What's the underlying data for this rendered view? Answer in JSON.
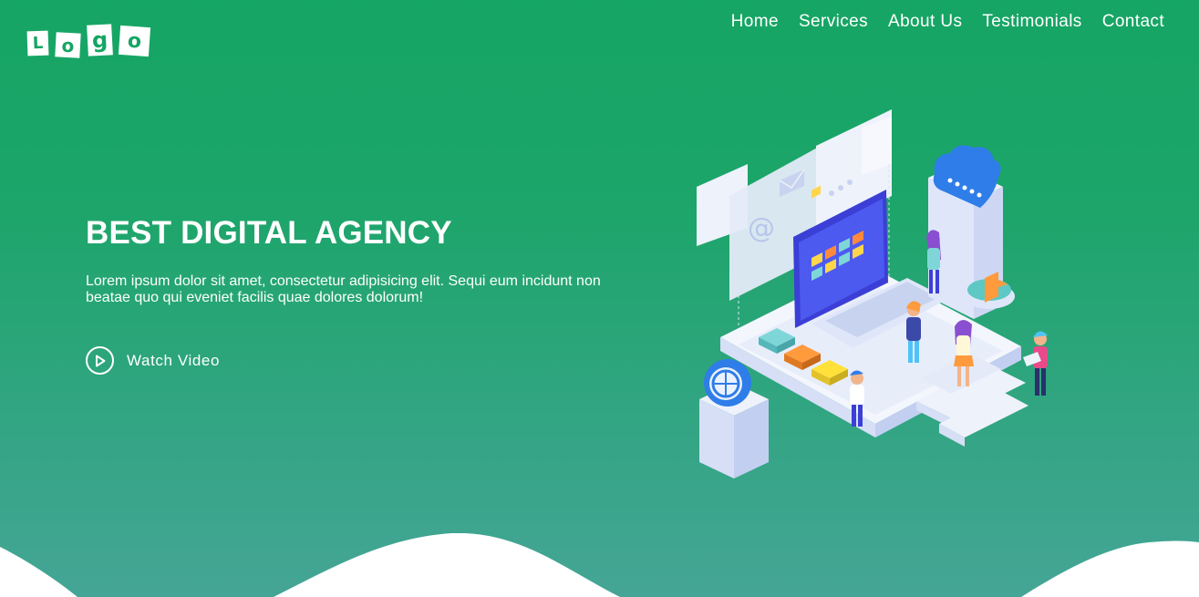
{
  "logo": {
    "letters": [
      "L",
      "o",
      "g",
      "o"
    ]
  },
  "nav": {
    "items": [
      "Home",
      "Services",
      "About Us",
      "Testimonials",
      "Contact"
    ]
  },
  "hero": {
    "title": "BEST DIGITAL AGENCY",
    "text": "Lorem ipsum dolor sit amet, consectetur adipisicing elit. Sequi eum incidunt non beatae quo qui eveniet facilis quae dolores dolorum!",
    "cta_label": "Watch Video",
    "cta_icon": "play-circle-icon"
  },
  "colors": {
    "brand": "#15a564",
    "background_bottom": "#45a596",
    "text": "#ffffff"
  }
}
